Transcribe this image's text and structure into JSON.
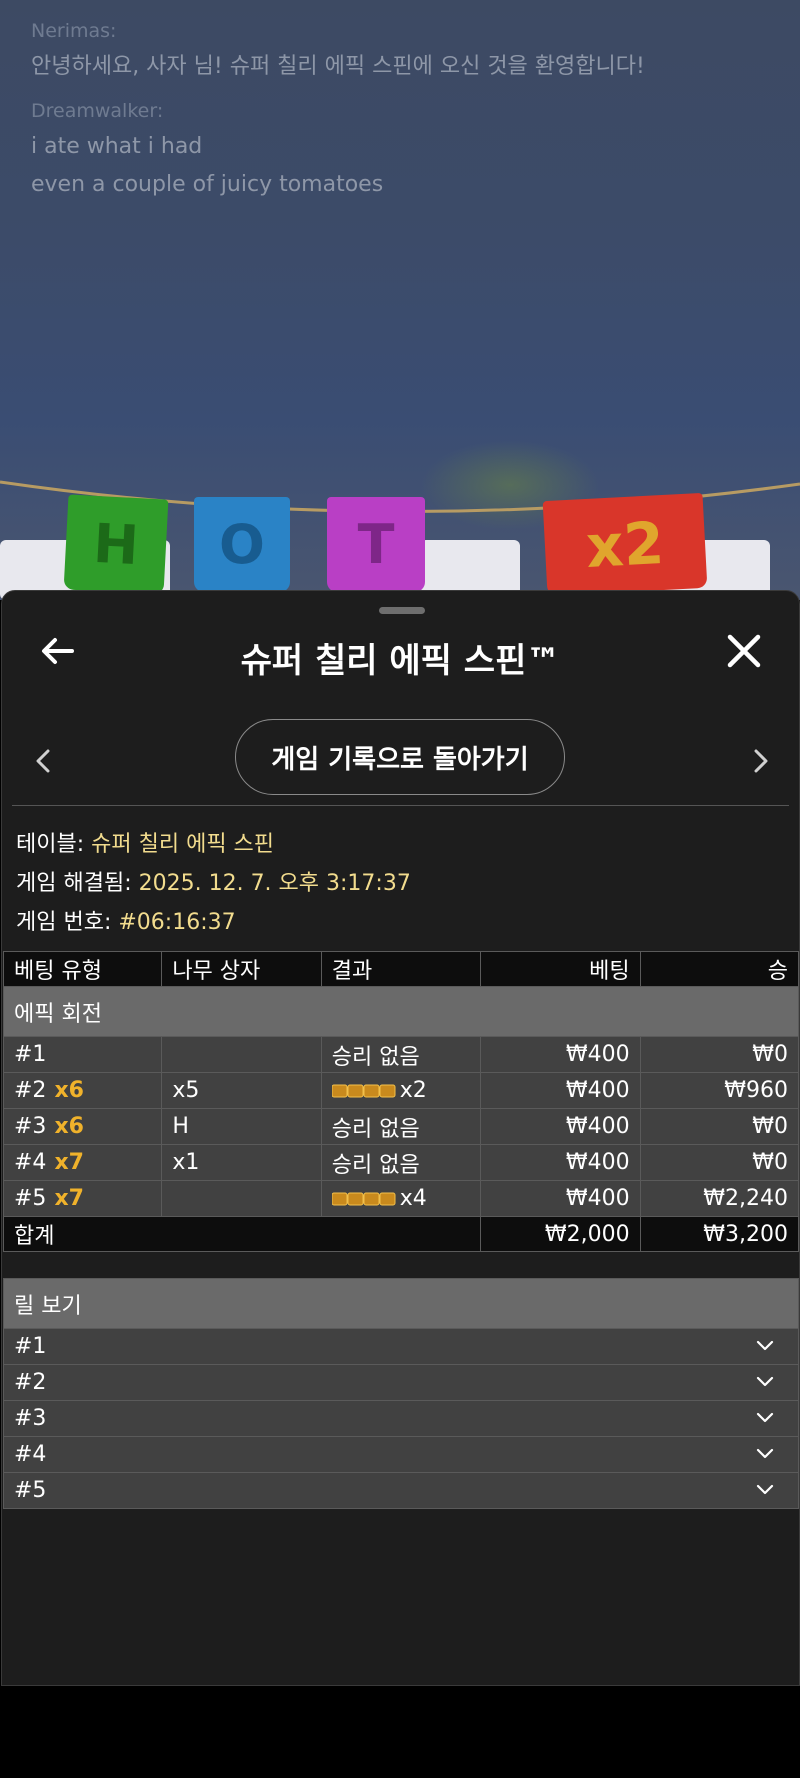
{
  "chat": [
    {
      "user": "Nerimas:",
      "messages": [
        "안녕하세요, 사자 님! 슈퍼 칠리 에픽 스핀에 오신 것을 환영합니다!"
      ]
    },
    {
      "user": "Dreamwalker:",
      "messages": [
        "i ate what i had",
        "even a couple of juicy tomatoes"
      ]
    }
  ],
  "panel": {
    "title": "슈퍼 칠리 에픽 스핀™",
    "back_to_history": "게임 기록으로 돌아가기",
    "info": [
      {
        "label": "테이블: ",
        "value": "슈퍼 칠리 에픽 스핀"
      },
      {
        "label": "게임 해결됨: ",
        "value": "2025. 12. 7. 오후 3:17:37"
      },
      {
        "label": "게임 번호: ",
        "value": "#06:16:37"
      }
    ]
  },
  "bets": {
    "headers": [
      "베팅 유형",
      "나무 상자",
      "결과",
      "베팅",
      "승"
    ],
    "section": "에픽 회전",
    "rows": [
      {
        "id": "#1",
        "mult": "",
        "box": "",
        "result": "승리 없음",
        "result_coins": false,
        "bet": "₩400",
        "win": "₩0"
      },
      {
        "id": "#2",
        "mult": "x6",
        "box": "x5",
        "result": "x2",
        "result_coins": true,
        "bet": "₩400",
        "win": "₩960"
      },
      {
        "id": "#3",
        "mult": "x6",
        "box": "H",
        "result": "승리 없음",
        "result_coins": false,
        "bet": "₩400",
        "win": "₩0"
      },
      {
        "id": "#4",
        "mult": "x7",
        "box": "x1",
        "result": "승리 없음",
        "result_coins": false,
        "bet": "₩400",
        "win": "₩0"
      },
      {
        "id": "#5",
        "mult": "x7",
        "box": "",
        "result": "x4",
        "result_coins": true,
        "bet": "₩400",
        "win": "₩2,240"
      }
    ],
    "total": {
      "label": "합계",
      "bet": "₩2,000",
      "win": "₩3,200"
    }
  },
  "reels": {
    "section": "릴 보기",
    "items": [
      "#1",
      "#2",
      "#3",
      "#4",
      "#5"
    ]
  },
  "colors": {
    "multiplier": "#f0b22b",
    "info_value": "#f2dc8e",
    "panel_bg": "#1d1d1d"
  }
}
